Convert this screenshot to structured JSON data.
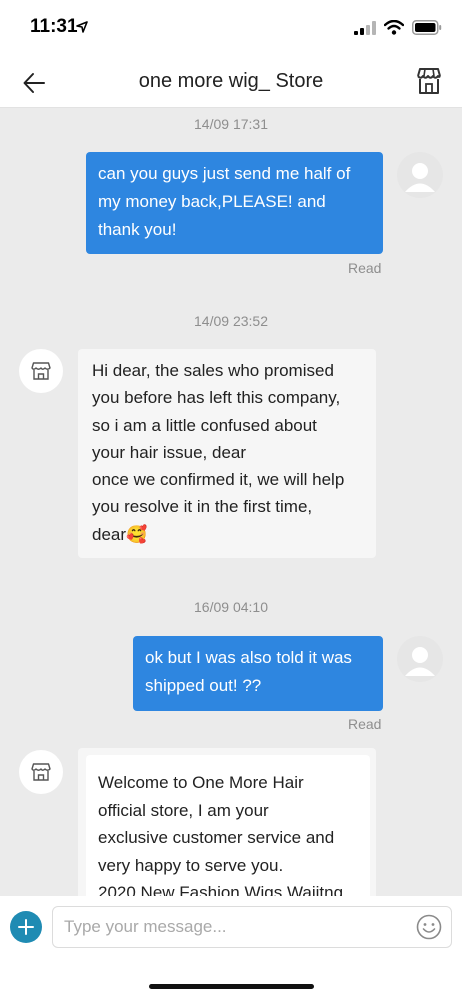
{
  "status_bar": {
    "time": "11:31"
  },
  "header": {
    "title": "one more wig_ Store"
  },
  "messages": {
    "ts1": "14/09 17:31",
    "out1": "can you guys just send me half of my money back,PLEASE! and thank you!",
    "read1": "Read",
    "ts2": "14/09 23:52",
    "in1_lines": [
      "Hi dear, the sales who promised",
      "you before has left this company,",
      "so i am a little confused about",
      "your hair issue, dear",
      "once we confirmed it, we will help",
      "you resolve it in the first time,"
    ],
    "in1_last": "dear",
    "in1_emoji": "🥰",
    "ts3": "16/09 04:10",
    "out2": "ok but I was also told it was shipped out! ??",
    "read2": "Read",
    "in2_lines": [
      "Welcome to One More Hair",
      "official store, I am your",
      "exclusive customer service and",
      "very happy to serve you.",
      "2020 New Fashion Wigs Waiitng"
    ]
  },
  "input": {
    "placeholder": "Type your message..."
  },
  "icons": {
    "back": "arrow-left-icon",
    "store": "storefront-icon",
    "add": "plus-icon",
    "emoji": "smiley-icon"
  },
  "colors": {
    "outgoing_bubble": "#2e86e0",
    "add_button": "#1f8bb3",
    "chat_background": "#ebebeb"
  }
}
